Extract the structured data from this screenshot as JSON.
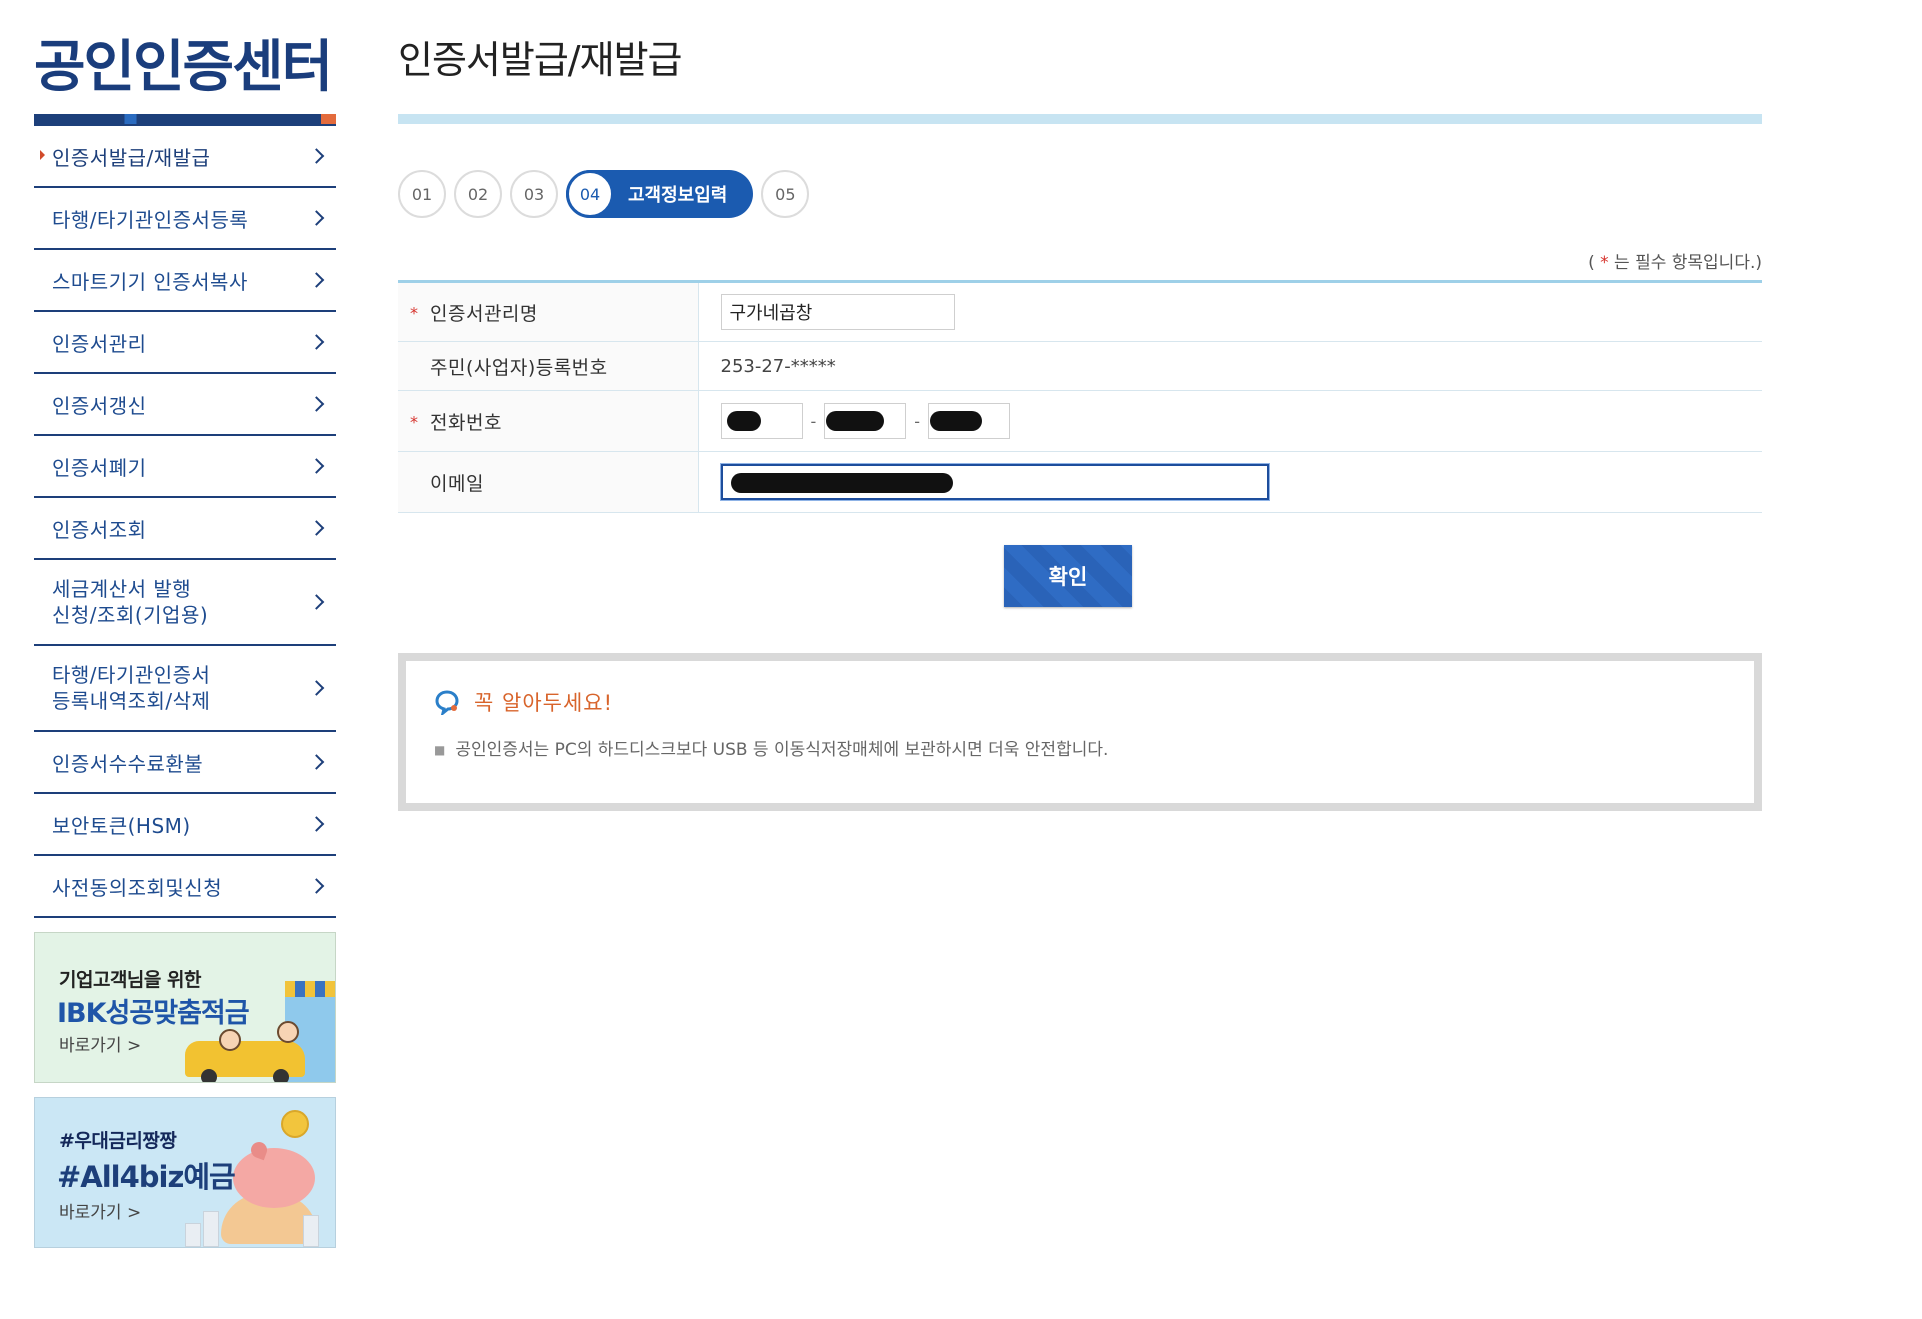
{
  "sidebar": {
    "title": "공인인증센터",
    "items": [
      {
        "label": "인증서발급/재발급",
        "active": true
      },
      {
        "label": "타행/타기관인증서등록"
      },
      {
        "label": "스마트기기 인증서복사"
      },
      {
        "label": "인증서관리"
      },
      {
        "label": "인증서갱신"
      },
      {
        "label": "인증서폐기"
      },
      {
        "label": "인증서조회"
      },
      {
        "label": "세금계산서 발행\n신청/조회(기업용)"
      },
      {
        "label": "타행/타기관인증서\n등록내역조회/삭제"
      },
      {
        "label": "인증서수수료환불"
      },
      {
        "label": "보안토큰(HSM)"
      },
      {
        "label": "사전동의조회및신청"
      }
    ],
    "banners": [
      {
        "line1": "기업고객님을 위한",
        "line2": "IBK성공맞춤적금",
        "link": "바로가기 >"
      },
      {
        "line1": "#우대금리짱짱",
        "line2": "#All4biz예금",
        "link": "바로가기 >"
      }
    ]
  },
  "main": {
    "title": "인증서발급/재발급",
    "steps": [
      {
        "num": "01"
      },
      {
        "num": "02"
      },
      {
        "num": "03"
      },
      {
        "num": "04",
        "label": "고객정보입력",
        "active": true
      },
      {
        "num": "05"
      }
    ],
    "required_note": {
      "open": "( ",
      "star": "*",
      "text": " 는 필수 항목입니다.)"
    },
    "form": {
      "name_label": "인증서관리명",
      "name_value": "구가네곱창",
      "regno_label": "주민(사업자)등록번호",
      "regno_value": "253-27-*****",
      "phone_label": "전화번호",
      "phone_sep": "-",
      "email_label": "이메일",
      "required_mark": "*"
    },
    "confirm_label": "확인",
    "notice": {
      "title": "꼭 알아두세요!",
      "text": "공인인증서는 PC의 하드디스크보다 USB 등 이동식저장매체에 보관하시면 더욱 안전합니다."
    }
  },
  "colors": {
    "brand_navy": "#1a3d7c",
    "step_blue": "#1b5bb0",
    "accent_orange": "#d8642b",
    "required_red": "#d6312b"
  }
}
